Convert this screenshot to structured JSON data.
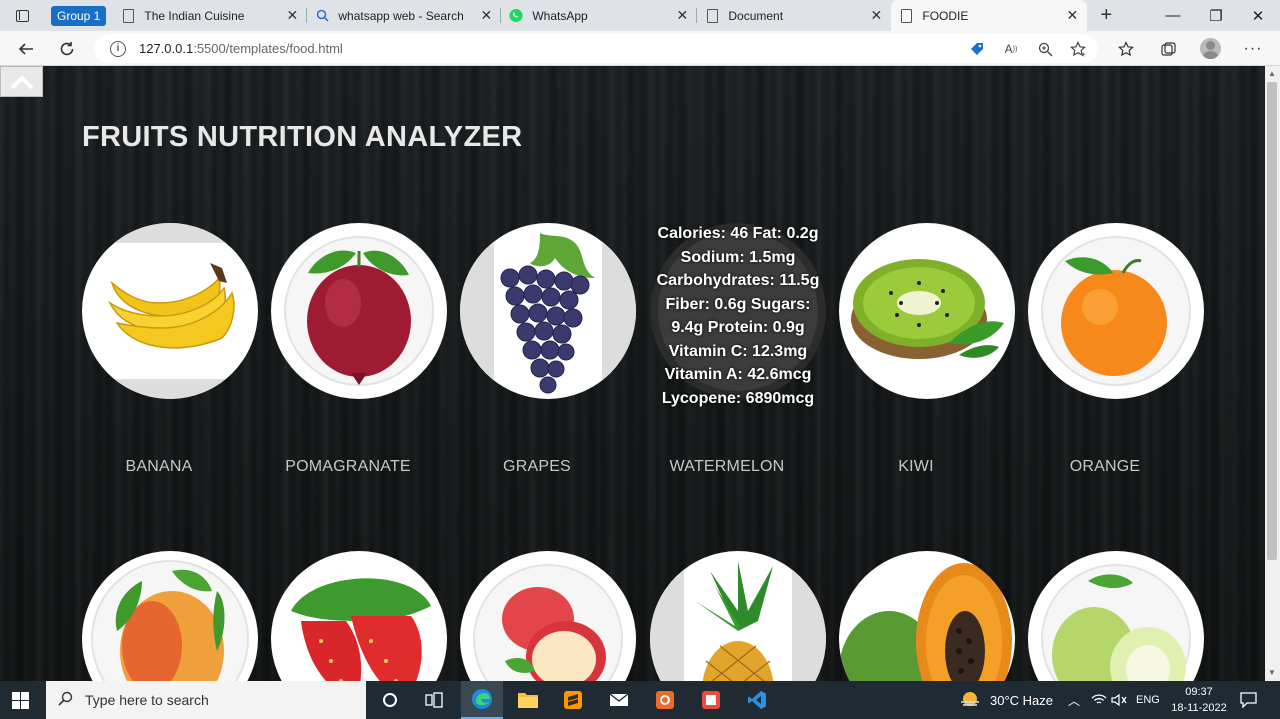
{
  "browser": {
    "tab_group": "Group 1",
    "tabs": [
      {
        "title": "The Indian Cuisine",
        "icon": "page-icon"
      },
      {
        "title": "whatsapp web - Search",
        "icon": "search-icon"
      },
      {
        "title": "WhatsApp",
        "icon": "whatsapp-icon"
      },
      {
        "title": "Document",
        "icon": "page-icon"
      },
      {
        "title": "FOODIE",
        "icon": "page-icon",
        "active": true
      }
    ],
    "url_host": "127.0.0.1",
    "url_rest": ":5500/templates/food.html"
  },
  "page": {
    "heading": "FRUITS NUTRITION ANALYZER",
    "fruits_row1": [
      {
        "name": "BANANA",
        "icon": "banana-image"
      },
      {
        "name": "POMAGRANATE",
        "icon": "pomegranate-image"
      },
      {
        "name": "GRAPES",
        "icon": "grapes-image"
      },
      {
        "name": "WATERMELON",
        "icon": "watermelon-image"
      },
      {
        "name": "KIWI",
        "icon": "kiwi-image"
      },
      {
        "name": "ORANGE",
        "icon": "orange-image"
      }
    ],
    "fruits_row2": [
      {
        "icon": "mango-image"
      },
      {
        "icon": "strawberry-image"
      },
      {
        "icon": "apple-image"
      },
      {
        "icon": "pineapple-image"
      },
      {
        "icon": "papaya-image"
      },
      {
        "icon": "guava-image"
      }
    ],
    "hover_nutrition": [
      "Calories: 46 Fat: 0.2g",
      "Sodium: 1.5mg",
      "Carbohydrates: 11.5g",
      "Fiber: 0.6g Sugars:",
      "9.4g Protein: 0.9g",
      "Vitamin C: 12.3mg",
      "Vitamin A: 42.6mcg",
      "Lycopene: 6890mcg"
    ]
  },
  "taskbar": {
    "search_placeholder": "Type here to search",
    "weather": "30°C  Haze",
    "language": "ENG",
    "time": "09:37",
    "date": "18-11-2022"
  },
  "colors": {
    "page_bg": "#16191a",
    "heading": "#e8e8e8",
    "fruit_label": "#c7c7c7",
    "tab_group": "#1a6fc4"
  }
}
